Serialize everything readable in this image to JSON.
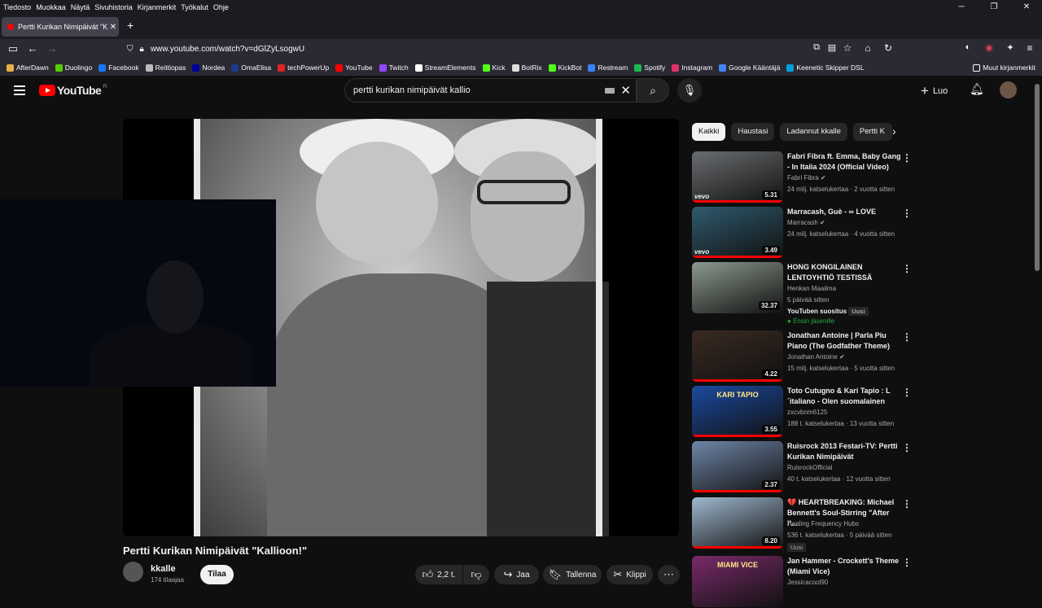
{
  "menubar": {
    "items": [
      "Tiedosto",
      "Muokkaa",
      "Näytä",
      "Sivuhistoria",
      "Kirjanmerkit",
      "Työkalut",
      "Ohje"
    ]
  },
  "browser": {
    "tab_title": "Pertti Kurikan Nimipäivät \"Kallio",
    "url": "www.youtube.com/watch?v=dGlZyLsogwU"
  },
  "bookmarks": [
    {
      "label": "AfterDawn",
      "color": "#e8b04a"
    },
    {
      "label": "Duolingo",
      "color": "#58cc02"
    },
    {
      "label": "Facebook",
      "color": "#1877f2"
    },
    {
      "label": "Reittiopas",
      "color": "#bbbbbb"
    },
    {
      "label": "Nordea",
      "color": "#0000a0"
    },
    {
      "label": "OmaElisa",
      "color": "#1e3a8a"
    },
    {
      "label": "techPowerUp",
      "color": "#e02424"
    },
    {
      "label": "YouTube",
      "color": "#ff0000"
    },
    {
      "label": "Twitch",
      "color": "#9146ff"
    },
    {
      "label": "StreamElements",
      "color": "#ffffff"
    },
    {
      "label": "Kick",
      "color": "#53fc18"
    },
    {
      "label": "BotRix",
      "color": "#dddddd"
    },
    {
      "label": "KickBot",
      "color": "#53fc18"
    },
    {
      "label": "Restream",
      "color": "#3b82f6"
    },
    {
      "label": "Spotify",
      "color": "#1db954"
    },
    {
      "label": "Instagram",
      "color": "#e1306c"
    },
    {
      "label": "Google Kääntäjä",
      "color": "#4285f4"
    },
    {
      "label": "Keenetic Skipper DSL",
      "color": "#00a0e0"
    }
  ],
  "bookmarks_other": "Muut kirjanmerkit",
  "yt": {
    "search_query": "pertti kurikan nimipäivät kallio",
    "logo": "YouTube",
    "region": "FI",
    "create_label": "Luo"
  },
  "video": {
    "title": "Pertti Kurikan Nimipäivät \"Kallioon!\"",
    "channel": "kkalle",
    "subscribers": "174 tilaajaa",
    "subscribe_label": "Tilaa",
    "likes": "2,2 t.",
    "share_label": "Jaa",
    "save_label": "Tallenna",
    "clip_label": "Klippi"
  },
  "chips": [
    "Kaikki",
    "Haustasi",
    "Ladannut kkalle",
    "Pertti K"
  ],
  "recommendations": [
    {
      "title": "Fabri Fibra ft. Emma, Baby Gang - In Italia 2024 (Official Video)",
      "channel": "Fabri Fibra",
      "meta": "24 milj. katselukertaa · 2 vuotta sitten",
      "duration": "5.31",
      "thumb": "#6a6d70",
      "verified": true
    },
    {
      "title": "Marracash, Guè - ∞ LOVE",
      "channel": "Marracash",
      "meta": "24 milj. katselukertaa · 4 vuotta sitten",
      "duration": "3.49",
      "thumb": "#2f5a6e",
      "verified": true
    },
    {
      "title": "HONG KONGILAINEN LENTOYHTIÖ TESTISSÄ",
      "channel": "Henkan Maailma",
      "meta": "5 päivää sitten",
      "duration": "32.37",
      "thumb": "#8c9a8e",
      "suggest": "YouTuben suositus",
      "new": "Uusi",
      "member": "Ensin jäsenille"
    },
    {
      "title": "Jonathan Antoine | Parla Piu Piano (The Godfather Theme)",
      "channel": "Jonathan Antoine",
      "meta": "15 milj. katselukertaa · 5 vuotta sitten",
      "duration": "4.22",
      "thumb": "#3a2a22",
      "verified": true
    },
    {
      "title": "Toto Cutugno & Kari Tapio : L´italiano - Olen suomalainen",
      "channel": "zxcvbnm6125",
      "meta": "188 t. katselukertaa · 13 vuotta sitten",
      "duration": "3.55",
      "thumb": "#1a4aa0",
      "overlay": "KARI TAPIO"
    },
    {
      "title": "Ruisrock 2013 Festari-TV: Pertti Kurikan Nimipäivät",
      "channel": "RuisrockOfficial",
      "meta": "40 t. katselukertaa · 12 vuotta sitten",
      "duration": "2.37",
      "thumb": "#6f86a8"
    },
    {
      "title": "💔 HEARTBREAKING: Michael Bennett's Soul-Stirring \"After I'...",
      "channel": "Healing Frequency Hubs",
      "meta": "536 t. katselukertaa · 5 päivää sitten",
      "duration": "8.20",
      "thumb": "#9fb8cf",
      "new": "Uusi"
    },
    {
      "title": "Jan Hammer - Crockett's Theme (Miami Vice)",
      "channel": "Jessicacool90",
      "meta": "",
      "duration": "",
      "thumb": "#7a2a6a",
      "overlay": "MIAMI VICE"
    }
  ]
}
